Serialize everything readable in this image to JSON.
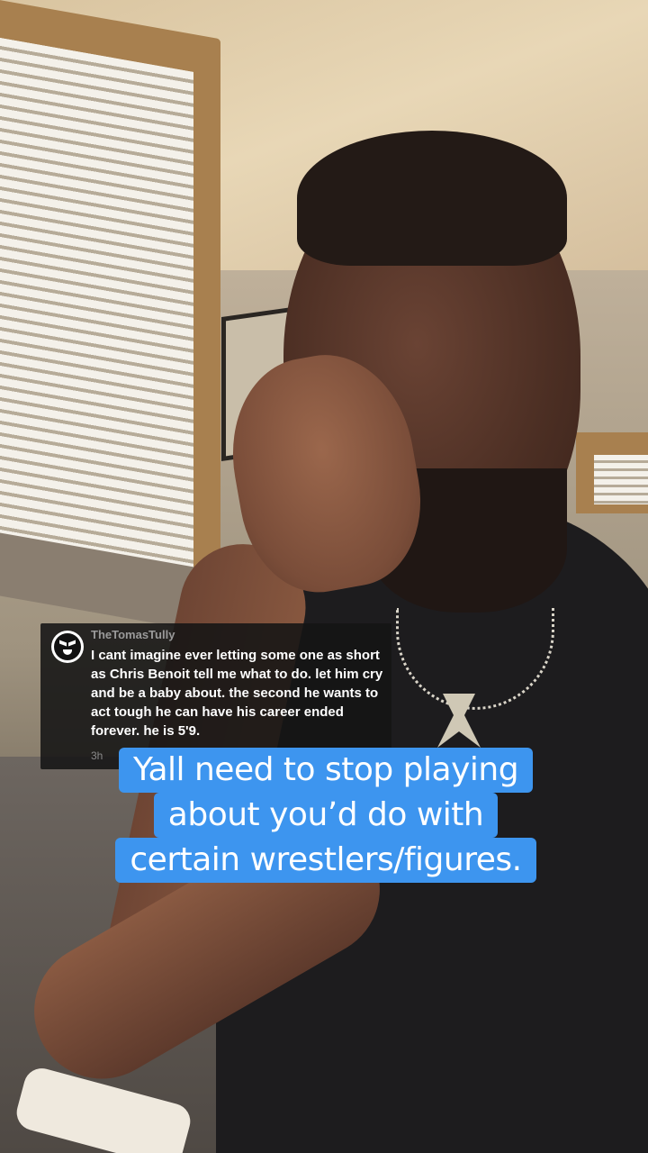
{
  "comment": {
    "username": "TheTomasTully",
    "text": "I cant imagine ever letting some one as short as Chris Benoit tell me what to do. let him cry and be a baby about. the second he wants to act tough he can have his career ended forever. he is 5'9.",
    "time": "3h",
    "avatar_icon": "wrestler-mask-avatar-icon"
  },
  "caption": {
    "lines": [
      "Yall need to stop playing",
      "about you’d do with",
      "certain wrestlers/figures."
    ],
    "background_color": "#3d95ef",
    "text_color": "#ffffff"
  }
}
